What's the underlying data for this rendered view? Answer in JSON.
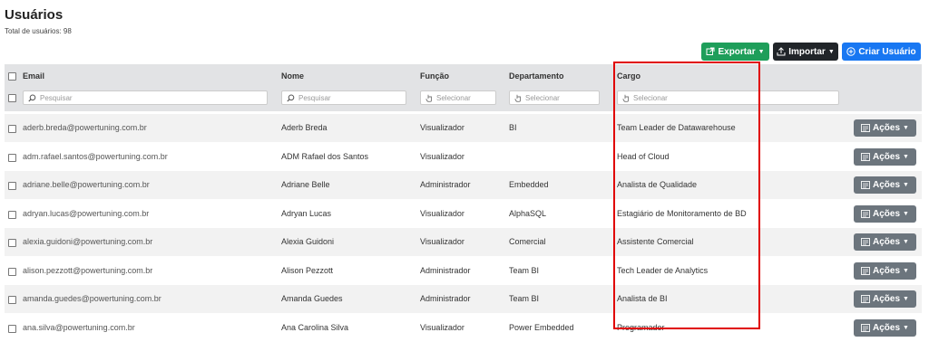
{
  "page": {
    "title": "Usuários",
    "total_label": "Total de usuários: 98"
  },
  "toolbar": {
    "export_label": "Exportar",
    "import_label": "Importar",
    "create_label": "Criar Usuário",
    "export_color": "#1e9e5a",
    "import_color": "#212529",
    "create_color": "#1877f2"
  },
  "table": {
    "columns": [
      "Email",
      "Nome",
      "Função",
      "Departamento",
      "Cargo"
    ],
    "filters": {
      "email_placeholder": "Pesquisar",
      "nome_placeholder": "Pesquisar",
      "funcao_placeholder": "Selecionar",
      "departamento_placeholder": "Selecionar",
      "cargo_placeholder": "Selecionar"
    },
    "actions_label": "Ações",
    "rows": [
      {
        "email": "aderb.breda@powertuning.com.br",
        "nome": "Aderb Breda",
        "funcao": "Visualizador",
        "departamento": "BI",
        "cargo": "Team Leader de Datawarehouse"
      },
      {
        "email": "adm.rafael.santos@powertuning.com.br",
        "nome": "ADM Rafael dos Santos",
        "funcao": "Visualizador",
        "departamento": "",
        "cargo": "Head of Cloud"
      },
      {
        "email": "adriane.belle@powertuning.com.br",
        "nome": "Adriane Belle",
        "funcao": "Administrador",
        "departamento": "Embedded",
        "cargo": "Analista de Qualidade"
      },
      {
        "email": "adryan.lucas@powertuning.com.br",
        "nome": "Adryan Lucas",
        "funcao": "Visualizador",
        "departamento": "AlphaSQL",
        "cargo": "Estagiário de Monitoramento de BD"
      },
      {
        "email": "alexia.guidoni@powertuning.com.br",
        "nome": "Alexia Guidoni",
        "funcao": "Visualizador",
        "departamento": "Comercial",
        "cargo": "Assistente Comercial"
      },
      {
        "email": "alison.pezzott@powertuning.com.br",
        "nome": "Alison Pezzott",
        "funcao": "Administrador",
        "departamento": "Team BI",
        "cargo": "Tech Leader de Analytics"
      },
      {
        "email": "amanda.guedes@powertuning.com.br",
        "nome": "Amanda Guedes",
        "funcao": "Administrador",
        "departamento": "Team BI",
        "cargo": "Analista de BI"
      },
      {
        "email": "ana.silva@powertuning.com.br",
        "nome": "Ana Carolina Silva",
        "funcao": "Visualizador",
        "departamento": "Power Embedded",
        "cargo": "Programador"
      }
    ]
  },
  "highlight": {
    "color": "#e00000"
  }
}
